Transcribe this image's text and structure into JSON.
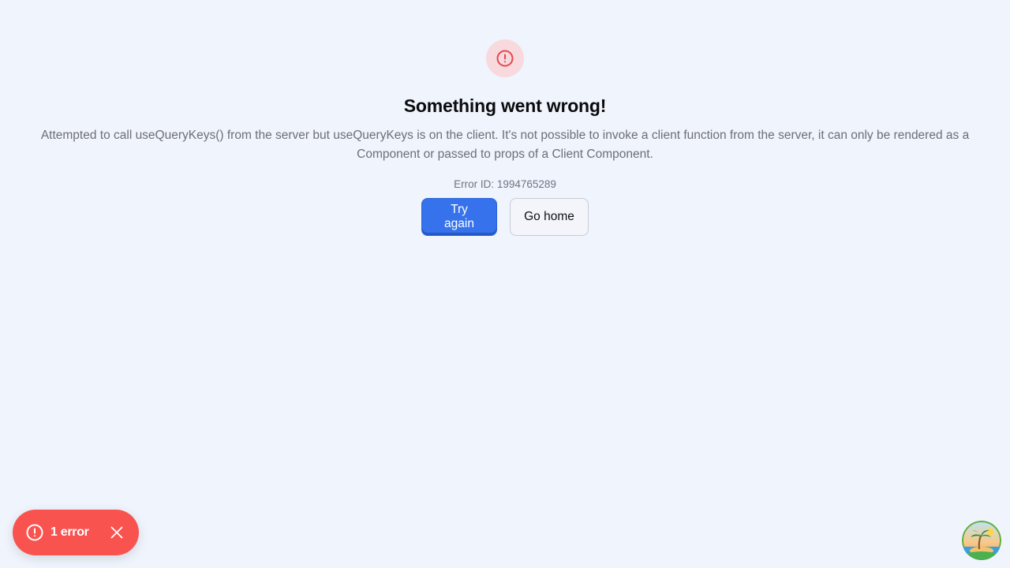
{
  "error_page": {
    "icon": "alert-circle-icon",
    "title": "Something went wrong!",
    "message": "Attempted to call useQueryKeys() from the server but useQueryKeys is on the client. It's not possible to invoke a client function from the server, it can only be rendered as a Component or passed to props of a Client Component.",
    "error_id": "Error ID: 1994765289",
    "actions": {
      "retry_label": "Try again",
      "home_label": "Go home"
    }
  },
  "error_toast": {
    "label": "1 error",
    "icon": "alert-circle-icon",
    "close_icon": "close-icon"
  },
  "corner_avatar": {
    "icon": "island-palm-icon"
  },
  "colors": {
    "background": "#eff4fd",
    "primary": "#3672ec",
    "danger": "#f9534f",
    "danger_soft": "#f7d9de",
    "icon_red": "#e5484d"
  }
}
